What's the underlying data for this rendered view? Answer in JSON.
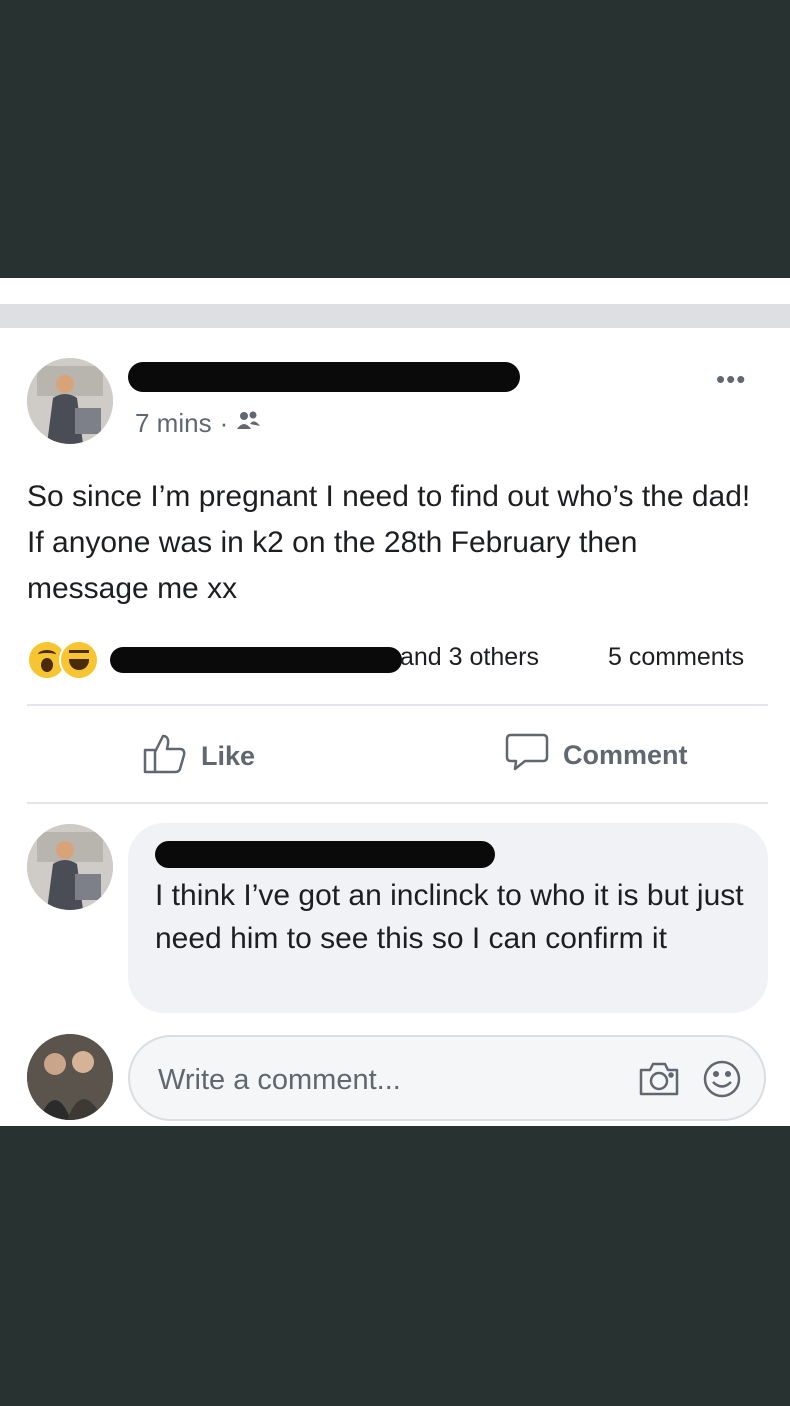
{
  "post": {
    "time": "7 mins",
    "separator": "·",
    "more_label": "•••",
    "text": "So since I’m pregnant I need to find out who’s the dad! If anyone was in k2 on the 28th February then message me xx"
  },
  "reactions": {
    "others_text": "and 3 others",
    "comments_count": "5 comments"
  },
  "actions": {
    "like_label": "Like",
    "comment_label": "Comment"
  },
  "comment": {
    "text": "I think I’ve got an inclinck to who it is but just need him to see this so I can confirm it"
  },
  "composer": {
    "placeholder": "Write a comment..."
  },
  "colors": {
    "background": "#283230",
    "secondary_text": "#606770",
    "bubble": "#f0f2f5"
  }
}
